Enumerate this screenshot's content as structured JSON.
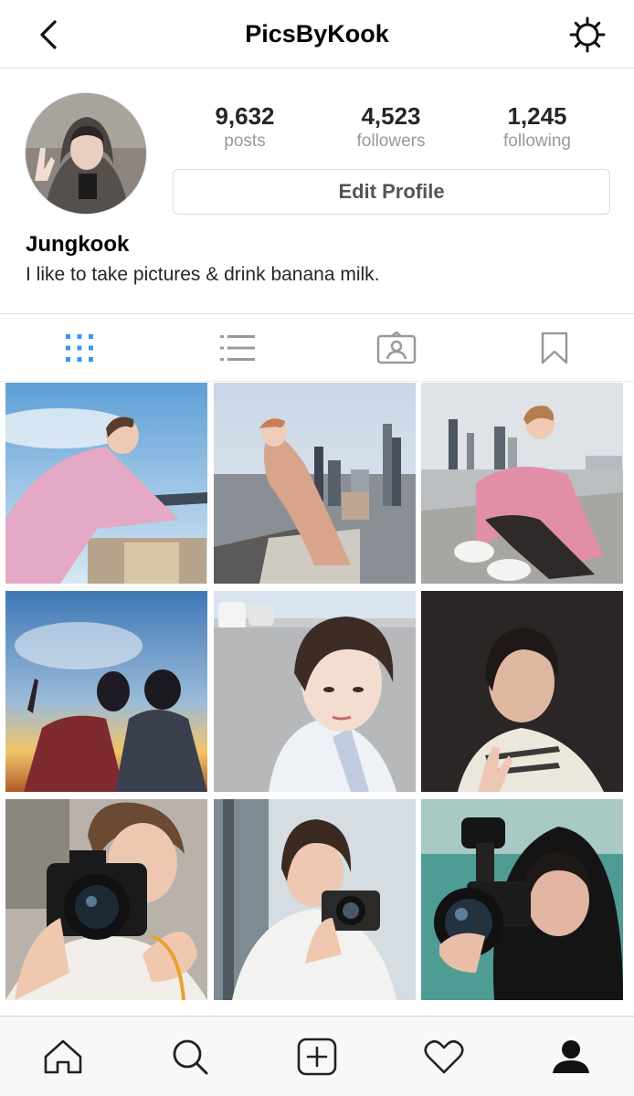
{
  "header": {
    "title": "PicsByKook",
    "back_icon": "chevron-left-icon",
    "settings_icon": "gear-icon"
  },
  "profile": {
    "posts_count": "9,632",
    "posts_label": "posts",
    "followers_count": "4,523",
    "followers_label": "followers",
    "following_count": "1,245",
    "following_label": "following",
    "edit_button_label": "Edit Profile",
    "name": "Jungkook",
    "bio": "I like to take pictures & drink banana milk."
  },
  "tabs": [
    {
      "icon": "grid-icon",
      "active": true
    },
    {
      "icon": "list-icon",
      "active": false
    },
    {
      "icon": "tagged-icon",
      "active": false
    },
    {
      "icon": "bookmark-icon",
      "active": false
    }
  ],
  "posts": [
    {
      "scene": "pink jacket, sky and railing"
    },
    {
      "scene": "leaning on rooftop, city skyline"
    },
    {
      "scene": "sitting on rooftop ledge, city skyline"
    },
    {
      "scene": "silhouettes against sunset sky"
    },
    {
      "scene": "selfie in parking lot"
    },
    {
      "scene": "peace sign, dark background"
    },
    {
      "scene": "holding camera"
    },
    {
      "scene": "holding small camera"
    },
    {
      "scene": "black hoodie with video camera"
    }
  ],
  "bottom_nav": [
    {
      "icon": "home-icon"
    },
    {
      "icon": "search-icon"
    },
    {
      "icon": "add-post-icon"
    },
    {
      "icon": "heart-icon"
    },
    {
      "icon": "profile-icon",
      "active": true
    }
  ],
  "colors": {
    "accent": "#3897f0",
    "muted": "#999999",
    "border": "#dbdbdb"
  }
}
